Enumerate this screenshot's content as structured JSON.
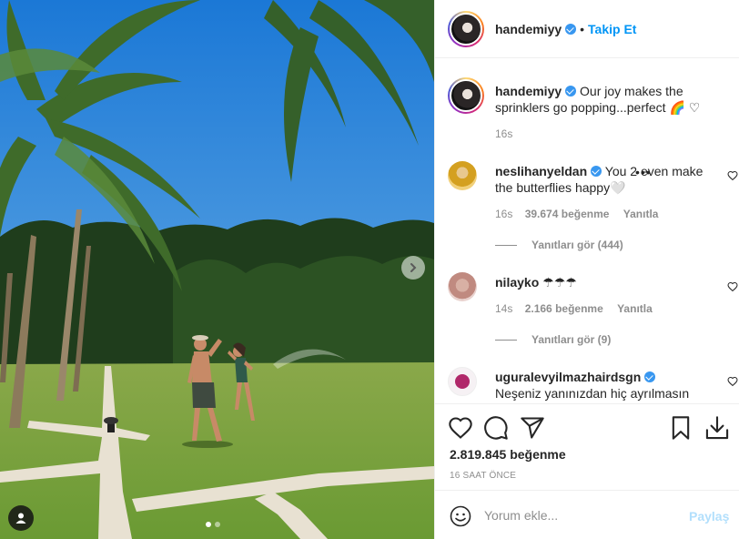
{
  "post": {
    "username": "handemiyy",
    "separator": "•",
    "follow_label": "Takip Et",
    "caption_text": "Our joy makes the sprinklers go popping...perfect 🌈 ♡",
    "caption_age": "16s",
    "likes_count": "2.819.845",
    "likes_word": "beğenme",
    "posted_ago": "16 SAAT ÖNCE"
  },
  "comments": [
    {
      "username": "neslihanyeldan",
      "verified": true,
      "text": "You 2 even make the butterflies happy🤍",
      "age": "16s",
      "likes": "39.674 beğenme",
      "reply_label": "Yanıtla",
      "more_label": "•••",
      "view_replies": "Yanıtları gör (444)"
    },
    {
      "username": "nilayko",
      "verified": false,
      "text": "☂☂☂",
      "age": "14s",
      "likes": "2.166 beğenme",
      "reply_label": "Yanıtla",
      "view_replies": "Yanıtları gör (9)"
    },
    {
      "username": "uguralevyilmazhairdsgn",
      "verified": true,
      "text": "Neşeniz yanınızdan hiç ayrılmasın"
    }
  ],
  "comment_box": {
    "placeholder": "Yorum ekle...",
    "post_label": "Paylaş"
  },
  "carousel": {
    "total": 2,
    "active": 1
  },
  "icons": [
    "chevron-right-icon",
    "user-tag-icon",
    "heart-icon",
    "comment-icon",
    "share-icon",
    "bookmark-icon",
    "download-icon",
    "emoji-icon"
  ],
  "colors": {
    "accent": "#0095f6",
    "verified": "#3897f0",
    "muted": "#8e8e8e",
    "post_disabled": "#b2dffc"
  }
}
